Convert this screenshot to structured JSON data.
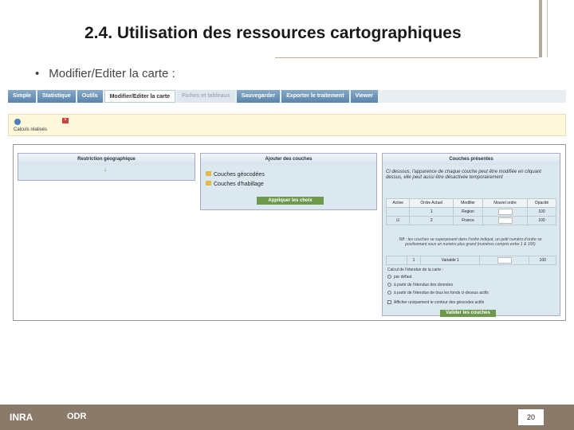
{
  "slide": {
    "title": "2.4. Utilisation des ressources cartographiques",
    "bullet_mark": "•",
    "bullet": "Modifier/Editer la carte :",
    "page_number": "20"
  },
  "tabs": [
    {
      "label": "Simple"
    },
    {
      "label": "Statistique"
    },
    {
      "label": "Outils"
    },
    {
      "label": "Modifier/Editer la carte"
    },
    {
      "label": "Fiches et tableaux"
    },
    {
      "label": "Sauvegarder"
    },
    {
      "label": "Exporter le traitement"
    },
    {
      "label": "Viewer"
    }
  ],
  "infobar": {
    "text": "Calculs réalisés"
  },
  "panels": {
    "restriction": {
      "title": "Restriction géographique",
      "arrow": "↓"
    },
    "ajouter": {
      "title": "Ajouter des couches",
      "items": [
        "Couches géocodées",
        "Couches d'habillage"
      ],
      "button": "Appliquer les choix"
    },
    "couches": {
      "title": "Couches présentes",
      "desc": "Ci dessous, l'apparence de chaque couche peut être modifiée en cliquant dessus, elle peut aussi être désactivée temporairement",
      "headers": [
        "Active",
        "Ordre Actuel",
        "Modifier",
        "Nouvel ordre",
        "Opacité"
      ],
      "rows": [
        {
          "order": "1",
          "name": "Region",
          "opacity": "100"
        },
        {
          "order": "2",
          "name": "France",
          "opacity": "100"
        }
      ],
      "note": "NB : les couches se superposent dans l'ordre indiqué, un petit numéro d'ordre se positionnant sous un numéro plus grand (numéros compris entre 1 & 100)",
      "row3": {
        "order": "1",
        "name": "Variable 1",
        "opacity": "100"
      },
      "extent_label": "Calcul de l'étendue de la carte :",
      "options": [
        "par défaut",
        "à partir de l'étendue des données",
        "à partir de l'étendue de tous les fonds ci-dessus actifs",
        "Afficher uniquement le contour des géocodes actifs"
      ],
      "button": "Valider les couches"
    }
  },
  "footer": {
    "logo1": "INRA",
    "logo2": "ODR"
  }
}
